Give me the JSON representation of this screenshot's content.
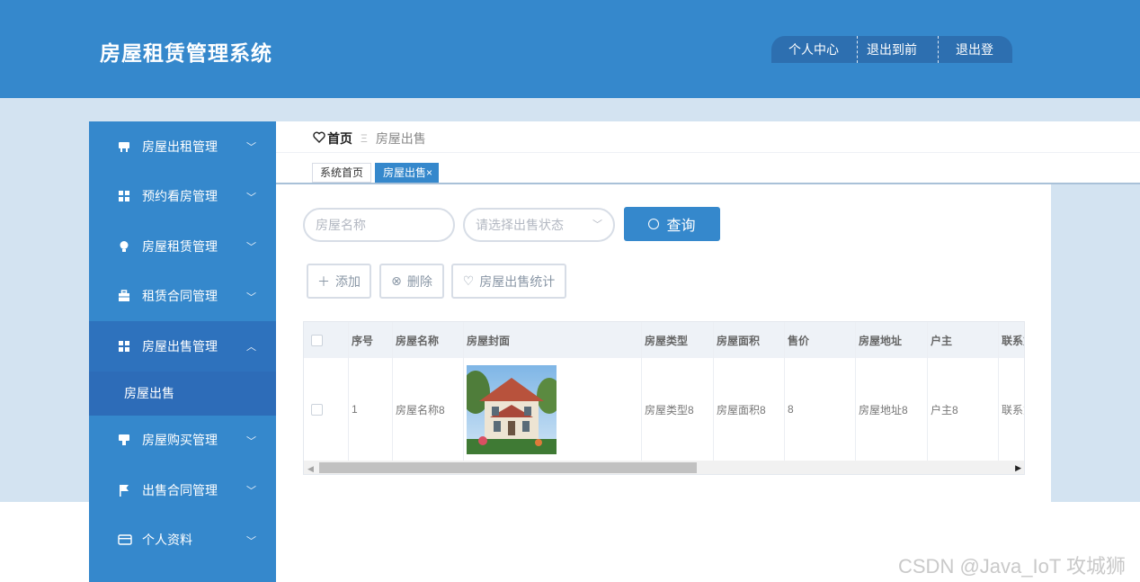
{
  "header": {
    "title": "房屋租赁管理系统",
    "actions": [
      "个人中心",
      "退出到前台",
      "退出登录"
    ]
  },
  "sidebar": {
    "items": [
      {
        "label": "房屋出租管理",
        "icon": "house-icon"
      },
      {
        "label": "预约看房管理",
        "icon": "grid-icon"
      },
      {
        "label": "房屋租赁管理",
        "icon": "lightbulb-icon"
      },
      {
        "label": "租赁合同管理",
        "icon": "briefcase-icon"
      },
      {
        "label": "房屋出售管理",
        "icon": "grid-icon",
        "expanded": true
      },
      {
        "label": "房屋购买管理",
        "icon": "cup-icon"
      },
      {
        "label": "出售合同管理",
        "icon": "flag-icon"
      },
      {
        "label": "个人资料",
        "icon": "card-icon"
      }
    ],
    "submenu": [
      "房屋出售"
    ]
  },
  "breadcrumb": {
    "home": "首页",
    "separator": "Ξ",
    "current": "房屋出售"
  },
  "tabs": [
    {
      "label": "系统首页",
      "active": false
    },
    {
      "label": "房屋出售",
      "active": true
    }
  ],
  "search": {
    "name_placeholder": "房屋名称",
    "status_placeholder": "请选择出售状态",
    "query_label": "查询"
  },
  "toolbar": {
    "add_label": "添加",
    "delete_label": "删除",
    "stats_label": "房屋出售统计"
  },
  "table": {
    "columns": [
      "序号",
      "房屋名称",
      "房屋封面",
      "房屋类型",
      "房屋面积",
      "售价",
      "房屋地址",
      "户主",
      "联系方"
    ],
    "rows": [
      [
        "1",
        "房屋名称8",
        "",
        "房屋类型8",
        "房屋面积8",
        "8",
        "房屋地址8",
        "户主8",
        "联系方"
      ]
    ]
  },
  "watermark": "CSDN @Java_IoT 攻城狮",
  "colors": {
    "primary": "#3588cc",
    "active_menu": "#2e72bd",
    "band": "#d3e3f1"
  }
}
